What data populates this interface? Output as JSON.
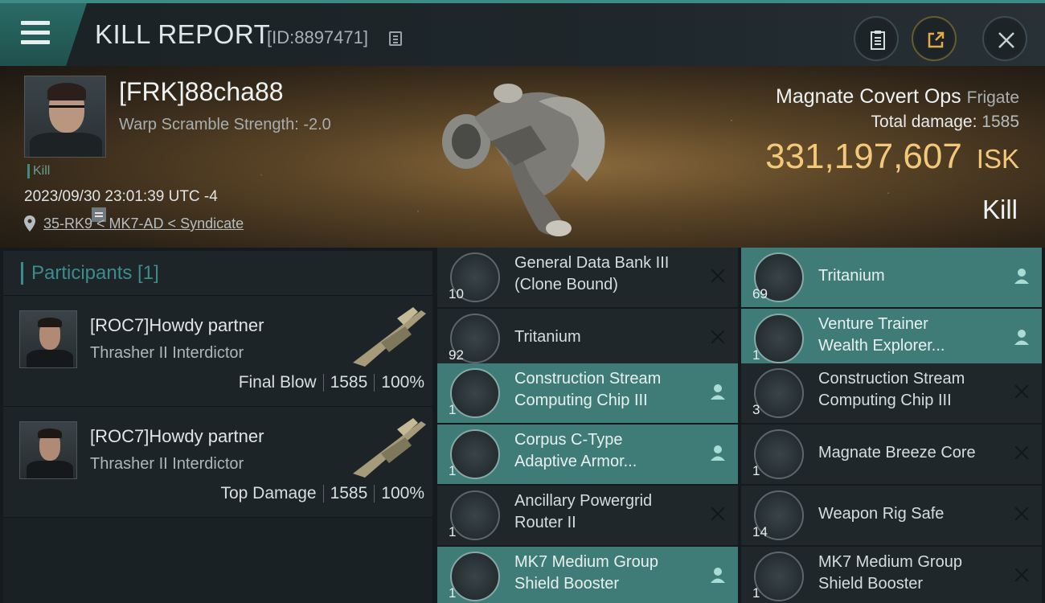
{
  "header": {
    "title": "KILL REPORT",
    "report_id": "[ID:8897471]"
  },
  "victim": {
    "name": "[FRK]88cha88",
    "warp_scramble": "Warp Scramble Strength: -2.0",
    "tag": "Kill",
    "datetime": "2023/09/30 23:01:39 UTC -4",
    "location": "35-RK9 < MK7-AD < Syndicate",
    "ship_name": "Magnate Covert Ops",
    "ship_class": "Frigate",
    "total_damage_label": "Total damage:",
    "total_damage": "1585",
    "isk_value": "331,197,607",
    "isk_unit": "ISK",
    "result": "Kill"
  },
  "participants": {
    "title": "Participants [1]",
    "rows": [
      {
        "name": "[ROC7]Howdy partner",
        "ship": "Thrasher II Interdictor",
        "label": "Final Blow",
        "damage": "1585",
        "percent": "100%"
      },
      {
        "name": "[ROC7]Howdy partner",
        "ship": "Thrasher II Interdictor",
        "label": "Top Damage",
        "damage": "1585",
        "percent": "100%"
      }
    ]
  },
  "items_left": [
    {
      "qty": "10",
      "name_line1": "General Data Bank III",
      "name_line2": "(Clone Bound)",
      "status": "destroyed",
      "icon": "data-bank-icon"
    },
    {
      "qty": "92",
      "name_line1": "Tritanium",
      "name_line2": "",
      "status": "destroyed",
      "icon": "tritanium-icon"
    },
    {
      "qty": "1",
      "name_line1": "Construction Stream",
      "name_line2": "Computing Chip III",
      "status": "dropped",
      "icon": "chip-icon"
    },
    {
      "qty": "1",
      "name_line1": "Corpus C-Type",
      "name_line2": "Adaptive Armor...",
      "status": "dropped",
      "icon": "armor-icon"
    },
    {
      "qty": "1",
      "name_line1": "Ancillary Powergrid",
      "name_line2": "Router II",
      "status": "destroyed",
      "icon": "powergrid-icon"
    },
    {
      "qty": "1",
      "name_line1": "MK7 Medium Group",
      "name_line2": "Shield Booster",
      "status": "dropped",
      "icon": "shield-booster-icon"
    }
  ],
  "items_right": [
    {
      "qty": "69",
      "name_line1": "Tritanium",
      "name_line2": "",
      "status": "dropped",
      "icon": "tritanium-icon"
    },
    {
      "qty": "1",
      "name_line1": "Venture Trainer",
      "name_line2": "Wealth Explorer...",
      "status": "dropped",
      "icon": "ship-skin-icon"
    },
    {
      "qty": "3",
      "name_line1": "Construction Stream",
      "name_line2": "Computing Chip III",
      "status": "destroyed",
      "icon": "chip-icon"
    },
    {
      "qty": "1",
      "name_line1": "Magnate Breeze Core",
      "name_line2": "",
      "status": "destroyed",
      "icon": "core-icon"
    },
    {
      "qty": "14",
      "name_line1": "Weapon Rig Safe",
      "name_line2": "",
      "status": "destroyed",
      "icon": "safe-icon"
    },
    {
      "qty": "1",
      "name_line1": "MK7 Medium Group",
      "name_line2": "Shield Booster",
      "status": "destroyed",
      "icon": "shield-booster-icon"
    }
  ],
  "colors": {
    "accent": "#3d8c8c",
    "dropped_row": "#3f7c78",
    "isk_gold": "#f2c97a"
  }
}
